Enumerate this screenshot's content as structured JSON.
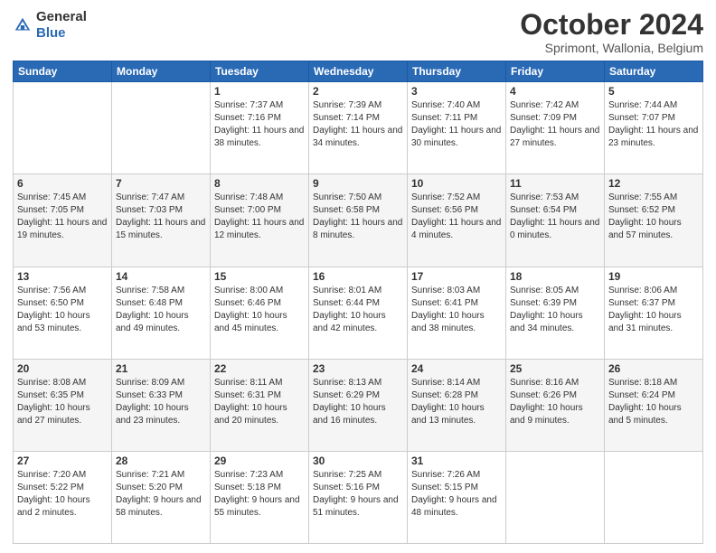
{
  "header": {
    "logo_general": "General",
    "logo_blue": "Blue",
    "month_title": "October 2024",
    "location": "Sprimont, Wallonia, Belgium"
  },
  "days_of_week": [
    "Sunday",
    "Monday",
    "Tuesday",
    "Wednesday",
    "Thursday",
    "Friday",
    "Saturday"
  ],
  "weeks": [
    [
      {
        "day": "",
        "info": ""
      },
      {
        "day": "",
        "info": ""
      },
      {
        "day": "1",
        "info": "Sunrise: 7:37 AM\nSunset: 7:16 PM\nDaylight: 11 hours and 38 minutes."
      },
      {
        "day": "2",
        "info": "Sunrise: 7:39 AM\nSunset: 7:14 PM\nDaylight: 11 hours and 34 minutes."
      },
      {
        "day": "3",
        "info": "Sunrise: 7:40 AM\nSunset: 7:11 PM\nDaylight: 11 hours and 30 minutes."
      },
      {
        "day": "4",
        "info": "Sunrise: 7:42 AM\nSunset: 7:09 PM\nDaylight: 11 hours and 27 minutes."
      },
      {
        "day": "5",
        "info": "Sunrise: 7:44 AM\nSunset: 7:07 PM\nDaylight: 11 hours and 23 minutes."
      }
    ],
    [
      {
        "day": "6",
        "info": "Sunrise: 7:45 AM\nSunset: 7:05 PM\nDaylight: 11 hours and 19 minutes."
      },
      {
        "day": "7",
        "info": "Sunrise: 7:47 AM\nSunset: 7:03 PM\nDaylight: 11 hours and 15 minutes."
      },
      {
        "day": "8",
        "info": "Sunrise: 7:48 AM\nSunset: 7:00 PM\nDaylight: 11 hours and 12 minutes."
      },
      {
        "day": "9",
        "info": "Sunrise: 7:50 AM\nSunset: 6:58 PM\nDaylight: 11 hours and 8 minutes."
      },
      {
        "day": "10",
        "info": "Sunrise: 7:52 AM\nSunset: 6:56 PM\nDaylight: 11 hours and 4 minutes."
      },
      {
        "day": "11",
        "info": "Sunrise: 7:53 AM\nSunset: 6:54 PM\nDaylight: 11 hours and 0 minutes."
      },
      {
        "day": "12",
        "info": "Sunrise: 7:55 AM\nSunset: 6:52 PM\nDaylight: 10 hours and 57 minutes."
      }
    ],
    [
      {
        "day": "13",
        "info": "Sunrise: 7:56 AM\nSunset: 6:50 PM\nDaylight: 10 hours and 53 minutes."
      },
      {
        "day": "14",
        "info": "Sunrise: 7:58 AM\nSunset: 6:48 PM\nDaylight: 10 hours and 49 minutes."
      },
      {
        "day": "15",
        "info": "Sunrise: 8:00 AM\nSunset: 6:46 PM\nDaylight: 10 hours and 45 minutes."
      },
      {
        "day": "16",
        "info": "Sunrise: 8:01 AM\nSunset: 6:44 PM\nDaylight: 10 hours and 42 minutes."
      },
      {
        "day": "17",
        "info": "Sunrise: 8:03 AM\nSunset: 6:41 PM\nDaylight: 10 hours and 38 minutes."
      },
      {
        "day": "18",
        "info": "Sunrise: 8:05 AM\nSunset: 6:39 PM\nDaylight: 10 hours and 34 minutes."
      },
      {
        "day": "19",
        "info": "Sunrise: 8:06 AM\nSunset: 6:37 PM\nDaylight: 10 hours and 31 minutes."
      }
    ],
    [
      {
        "day": "20",
        "info": "Sunrise: 8:08 AM\nSunset: 6:35 PM\nDaylight: 10 hours and 27 minutes."
      },
      {
        "day": "21",
        "info": "Sunrise: 8:09 AM\nSunset: 6:33 PM\nDaylight: 10 hours and 23 minutes."
      },
      {
        "day": "22",
        "info": "Sunrise: 8:11 AM\nSunset: 6:31 PM\nDaylight: 10 hours and 20 minutes."
      },
      {
        "day": "23",
        "info": "Sunrise: 8:13 AM\nSunset: 6:29 PM\nDaylight: 10 hours and 16 minutes."
      },
      {
        "day": "24",
        "info": "Sunrise: 8:14 AM\nSunset: 6:28 PM\nDaylight: 10 hours and 13 minutes."
      },
      {
        "day": "25",
        "info": "Sunrise: 8:16 AM\nSunset: 6:26 PM\nDaylight: 10 hours and 9 minutes."
      },
      {
        "day": "26",
        "info": "Sunrise: 8:18 AM\nSunset: 6:24 PM\nDaylight: 10 hours and 5 minutes."
      }
    ],
    [
      {
        "day": "27",
        "info": "Sunrise: 7:20 AM\nSunset: 5:22 PM\nDaylight: 10 hours and 2 minutes."
      },
      {
        "day": "28",
        "info": "Sunrise: 7:21 AM\nSunset: 5:20 PM\nDaylight: 9 hours and 58 minutes."
      },
      {
        "day": "29",
        "info": "Sunrise: 7:23 AM\nSunset: 5:18 PM\nDaylight: 9 hours and 55 minutes."
      },
      {
        "day": "30",
        "info": "Sunrise: 7:25 AM\nSunset: 5:16 PM\nDaylight: 9 hours and 51 minutes."
      },
      {
        "day": "31",
        "info": "Sunrise: 7:26 AM\nSunset: 5:15 PM\nDaylight: 9 hours and 48 minutes."
      },
      {
        "day": "",
        "info": ""
      },
      {
        "day": "",
        "info": ""
      }
    ]
  ]
}
